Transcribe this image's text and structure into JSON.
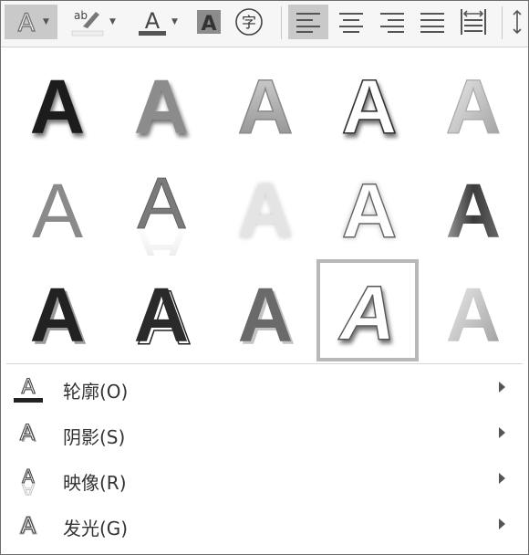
{
  "toolbar": {
    "buttons": [
      {
        "name": "text-effects-button",
        "icon": "text-effects-icon",
        "active": true
      },
      {
        "name": "highlight-color-button",
        "icon": "highlight-icon"
      },
      {
        "name": "font-color-button",
        "icon": "font-color-icon"
      },
      {
        "name": "character-shading-button",
        "icon": "character-shading-icon"
      },
      {
        "name": "enclose-characters-button",
        "icon": "enclosed-character-icon",
        "glyph": "字"
      },
      {
        "name": "align-left-button",
        "icon": "align-left-icon",
        "active": true
      },
      {
        "name": "align-center-button",
        "icon": "align-center-icon"
      },
      {
        "name": "align-right-button",
        "icon": "align-right-icon"
      },
      {
        "name": "justify-button",
        "icon": "justify-icon"
      },
      {
        "name": "distributed-button",
        "icon": "distributed-icon"
      }
    ],
    "highlight_glyph": "ab",
    "letter": "A"
  },
  "gallery": {
    "glyph": "A",
    "selected_index": 13,
    "styles": [
      "black-shadow",
      "gray-soft",
      "gray-bevel",
      "outline-shadow",
      "light-bevel",
      "gray-plain",
      "gray-reflection",
      "light-glow",
      "outline-white",
      "dark-gradient",
      "black-3d",
      "black-3d-outline",
      "gray-3d",
      "outline-selected",
      "light-gradient"
    ]
  },
  "menu": {
    "items": [
      {
        "label": "轮廓(O)",
        "icon": "outline-letter-icon"
      },
      {
        "label": "阴影(S)",
        "icon": "shadow-letter-icon"
      },
      {
        "label": "映像(R)",
        "icon": "reflection-letter-icon"
      },
      {
        "label": "发光(G)",
        "icon": "glow-letter-icon"
      }
    ]
  },
  "colors": {
    "accent_active": "#c9c9c9",
    "selection_border": "#b8b8b8",
    "text": "#333333"
  }
}
